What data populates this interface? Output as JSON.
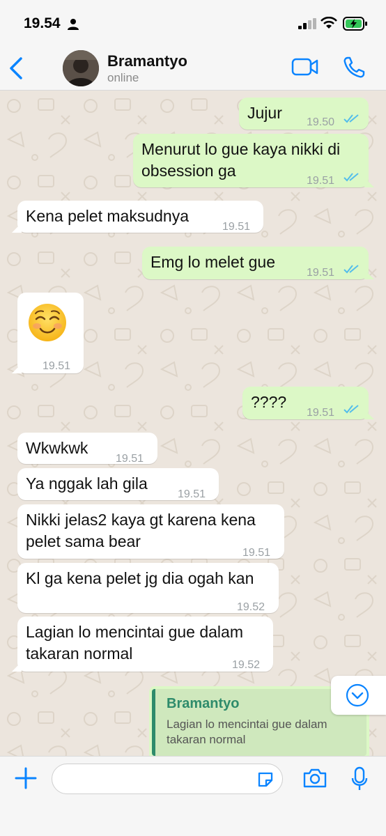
{
  "status_bar": {
    "time": "19.54"
  },
  "header": {
    "contact_name": "Bramantyo",
    "contact_status": "online"
  },
  "messages": [
    {
      "text": "Jujur",
      "time": "19.50",
      "direction": "out"
    },
    {
      "text": "Menurut lo gue kaya nikki di",
      "text2": "obsession ga",
      "time": "19.51",
      "direction": "out"
    },
    {
      "text": "Kena pelet maksudnya",
      "time": "19.51",
      "direction": "in"
    },
    {
      "text": "Emg lo melet gue",
      "time": "19.51",
      "direction": "out"
    },
    {
      "emoji": "smiling-face-icon",
      "time": "19.51",
      "direction": "in"
    },
    {
      "text": "????",
      "time": "19.51",
      "direction": "out"
    },
    {
      "text": "Wkwkwk",
      "time": "19.51",
      "direction": "in"
    },
    {
      "text": "Ya nggak lah gila",
      "time": "19.51",
      "direction": "in"
    },
    {
      "text": "Nikki jelas2 kaya gt karena kena",
      "text2": "pelet sama bear",
      "time": "19.51",
      "direction": "in"
    },
    {
      "text": "Kl ga kena pelet jg dia ogah kan",
      "time": "19.52",
      "direction": "in"
    },
    {
      "text": "Lagian lo mencintai gue dalam",
      "text2": "takaran normal",
      "time": "19.52",
      "direction": "in"
    }
  ],
  "reply": {
    "name": "Bramantyo",
    "text": "Lagian lo mencintai gue dalam takaran normal"
  },
  "input": {
    "placeholder": ""
  },
  "colors": {
    "accent": "#0a84ff",
    "out_bubble": "#dcf8c6",
    "in_bubble": "#ffffff",
    "chat_bg": "#ece5dd",
    "read_ticks": "#53bdeb"
  }
}
